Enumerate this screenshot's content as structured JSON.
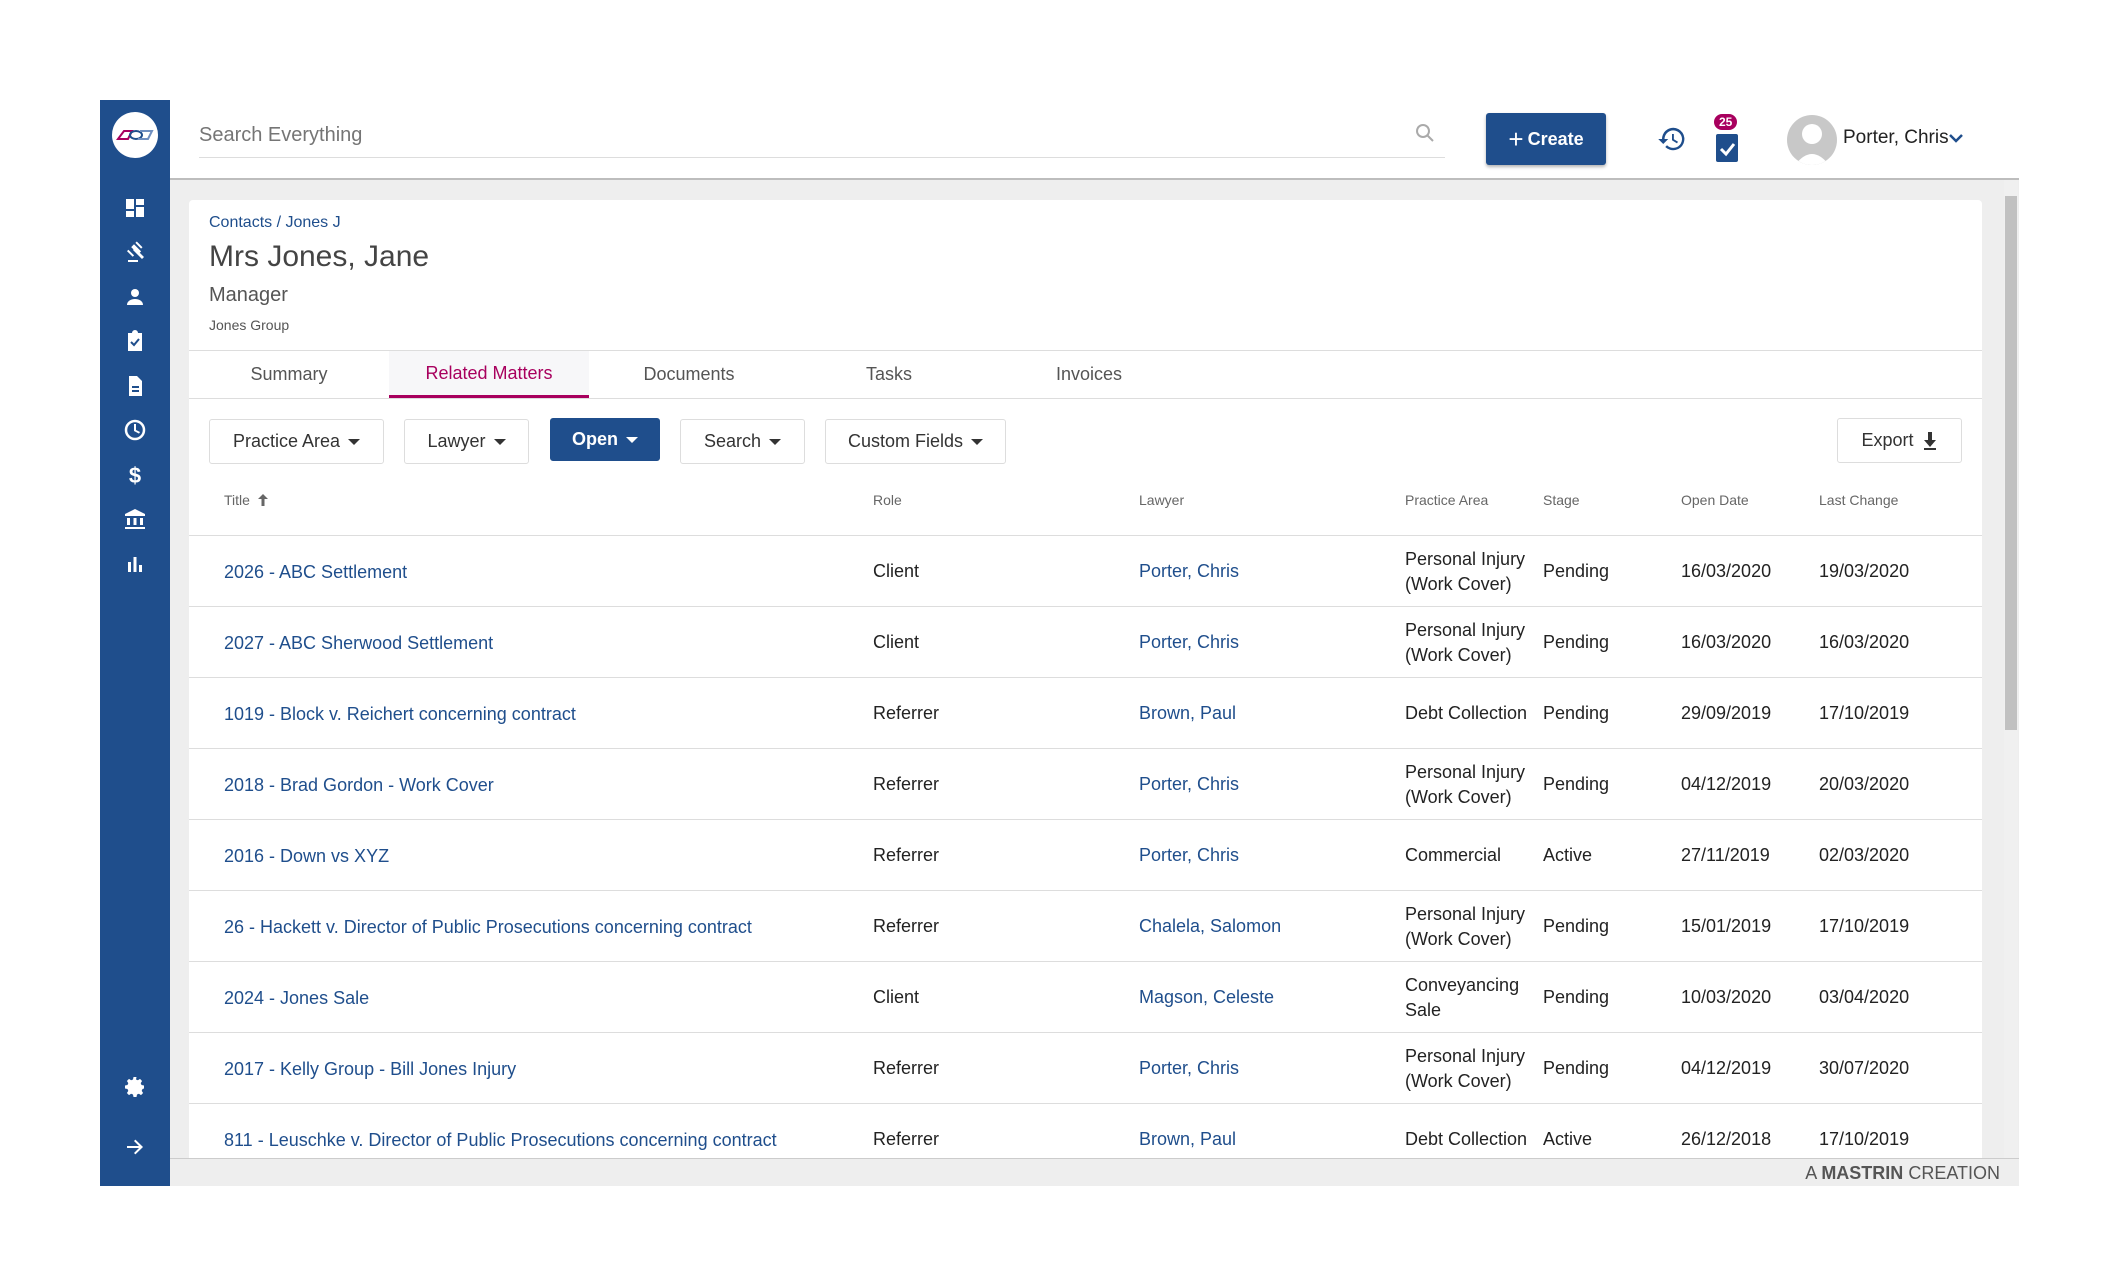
{
  "topbar": {
    "search_placeholder": "Search Everything",
    "create_label": "Create",
    "tasks_badge": "25",
    "user_name": "Porter, Chris"
  },
  "sidebar": {
    "items": [
      {
        "icon": "dashboard-icon"
      },
      {
        "icon": "gavel-icon"
      },
      {
        "icon": "person-icon"
      },
      {
        "icon": "clipboard-check-icon"
      },
      {
        "icon": "document-icon"
      },
      {
        "icon": "clock-icon"
      },
      {
        "icon": "dollar-icon"
      },
      {
        "icon": "bank-icon"
      },
      {
        "icon": "bar-chart-icon"
      }
    ],
    "bottom": [
      {
        "icon": "gear-icon"
      },
      {
        "icon": "arrow-right-icon"
      }
    ]
  },
  "contact": {
    "breadcrumb": "Contacts / Jones J",
    "name": "Mrs Jones, Jane",
    "position": "Manager",
    "organisation": "Jones Group"
  },
  "tabs": [
    {
      "label": "Summary"
    },
    {
      "label": "Related Matters",
      "active": true
    },
    {
      "label": "Documents"
    },
    {
      "label": "Tasks"
    },
    {
      "label": "Invoices"
    }
  ],
  "filters": {
    "practice_area": "Practice Area",
    "lawyer": "Lawyer",
    "status": "Open",
    "search": "Search",
    "custom_fields": "Custom Fields",
    "export": "Export"
  },
  "table": {
    "columns": [
      "Title",
      "Role",
      "Lawyer",
      "Practice Area",
      "Stage",
      "Open Date",
      "Last Change"
    ],
    "sort": {
      "column": "Title",
      "direction": "ascending"
    },
    "rows": [
      {
        "title": "2026 - ABC Settlement",
        "role": "Client",
        "lawyer": "Porter, Chris",
        "practice_area": "Personal Injury (Work Cover)",
        "stage": "Pending",
        "open_date": "16/03/2020",
        "last_change": "19/03/2020"
      },
      {
        "title": "2027 - ABC Sherwood Settlement",
        "role": "Client",
        "lawyer": "Porter, Chris",
        "practice_area": "Personal Injury (Work Cover)",
        "stage": "Pending",
        "open_date": "16/03/2020",
        "last_change": "16/03/2020"
      },
      {
        "title": "1019 - Block v. Reichert concerning contract",
        "role": "Referrer",
        "lawyer": "Brown, Paul",
        "practice_area": "Debt Collection",
        "stage": "Pending",
        "open_date": "29/09/2019",
        "last_change": "17/10/2019"
      },
      {
        "title": "2018 - Brad Gordon - Work Cover",
        "role": "Referrer",
        "lawyer": "Porter, Chris",
        "practice_area": "Personal Injury (Work Cover)",
        "stage": "Pending",
        "open_date": "04/12/2019",
        "last_change": "20/03/2020"
      },
      {
        "title": "2016 - Down vs XYZ",
        "role": "Referrer",
        "lawyer": "Porter, Chris",
        "practice_area": "Commercial",
        "stage": "Active",
        "open_date": "27/11/2019",
        "last_change": "02/03/2020"
      },
      {
        "title": "26 - Hackett v. Director of Public Prosecutions concerning contract",
        "role": "Referrer",
        "lawyer": "Chalela, Salomon",
        "practice_area": "Personal Injury (Work Cover)",
        "stage": "Pending",
        "open_date": "15/01/2019",
        "last_change": "17/10/2019"
      },
      {
        "title": "2024 - Jones Sale",
        "role": "Client",
        "lawyer": "Magson, Celeste",
        "practice_area": "Conveyancing Sale",
        "stage": "Pending",
        "open_date": "10/03/2020",
        "last_change": "03/04/2020"
      },
      {
        "title": "2017 - Kelly Group - Bill Jones Injury",
        "role": "Referrer",
        "lawyer": "Porter, Chris",
        "practice_area": "Personal Injury (Work Cover)",
        "stage": "Pending",
        "open_date": "04/12/2019",
        "last_change": "30/07/2020"
      },
      {
        "title": "811 - Leuschke v. Director of Public Prosecutions concerning contract",
        "role": "Referrer",
        "lawyer": "Brown, Paul",
        "practice_area": "Debt Collection",
        "stage": "Active",
        "open_date": "26/12/2018",
        "last_change": "17/10/2019"
      }
    ]
  },
  "footer": {
    "prefix": "A",
    "brand": "MASTRIN",
    "suffix": "CREATION"
  },
  "colors": {
    "primary": "#1f4e8c",
    "accent": "#a8005e"
  }
}
